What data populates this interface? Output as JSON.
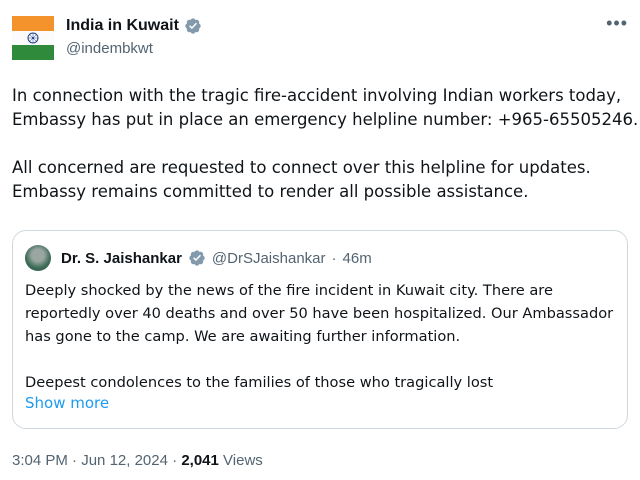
{
  "author": {
    "display_name": "India in Kuwait",
    "handle": "@indembkwt",
    "avatar_icon": "india-flag-icon",
    "verified_icon": "verified-badge-icon"
  },
  "more_icon_glyph": "•••",
  "tweet": {
    "lines": [
      "In connection with the tragic fire-accident involving Indian workers today,",
      "Embassy has put in place an emergency helpline number: +965-65505246.",
      "",
      "All concerned are requested to connect over this helpline for updates.",
      "Embassy remains committed to render all possible assistance."
    ]
  },
  "quote": {
    "display_name": "Dr. S. Jaishankar",
    "handle": "@DrSJaishankar",
    "separator": "·",
    "time": "46m",
    "lines": [
      "Deeply shocked by the news of the fire incident in Kuwait city. There are",
      "reportedly over 40 deaths and over 50 have been hospitalized. Our Ambassador",
      "has gone to the camp. We are awaiting further information.",
      "",
      "Deepest condolences to the families of those who tragically lost"
    ],
    "show_more": "Show more"
  },
  "meta": {
    "time": "3:04 PM",
    "separator": "·",
    "date": "Jun 12, 2024",
    "views_count": "2,041",
    "views_label": "Views"
  },
  "colors": {
    "text": "#0f1419",
    "secondary": "#536471",
    "link": "#1d9bf0",
    "verified": "#829aab",
    "border": "#cfd9de"
  }
}
